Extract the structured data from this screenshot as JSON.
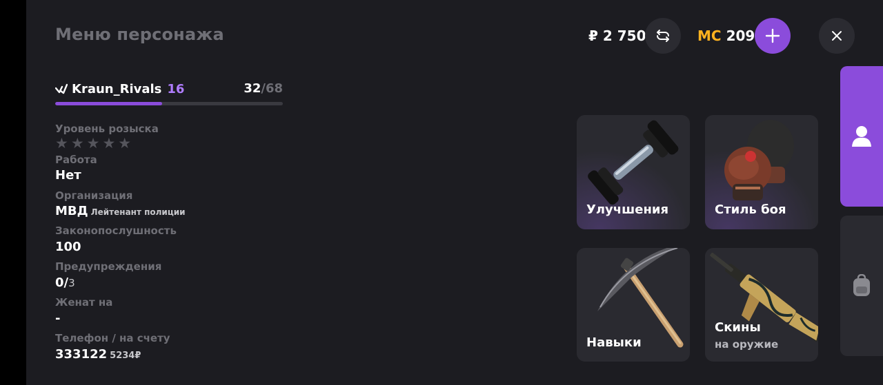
{
  "header": {
    "title": "Меню персонажа",
    "money": "₽ 2 750",
    "mc_tag": "MC",
    "mc_value": "209"
  },
  "player": {
    "name": "Kraun_Rivals",
    "level": "16",
    "xp_current": "32",
    "xp_max": "/68",
    "xp_progress": 0.47
  },
  "info": {
    "wanted_label": "Уровень розыска",
    "wanted_stars": "★★★★★",
    "job_label": "Работа",
    "job_value": "Нет",
    "org_label": "Организация",
    "org_value": "МВД",
    "org_rank": "Лейтенант полиции",
    "law_label": "Законопослушность",
    "law_value": "100",
    "warn_label": "Предупреждения",
    "warn_value": "0/",
    "warn_max": "3",
    "married_label": "Женат на",
    "married_value": "-",
    "phone_label": "Телефон / на счету",
    "phone_value": "333122",
    "phone_balance": "5234₽"
  },
  "tiles": {
    "upgrades": "Улучшения",
    "fight_style": "Стиль боя",
    "skills": "Навыки",
    "skins": "Скины",
    "skins_sub": "на оружие"
  },
  "colors": {
    "accent": "#8b4cdb",
    "level": "#b07dff",
    "mc": "#ffb21f",
    "panel": "#1c1c21"
  },
  "icons": {
    "refresh": "refresh-icon",
    "plus": "plus-icon",
    "close": "close-icon",
    "profile": "person-icon",
    "inventory": "backpack-icon"
  }
}
